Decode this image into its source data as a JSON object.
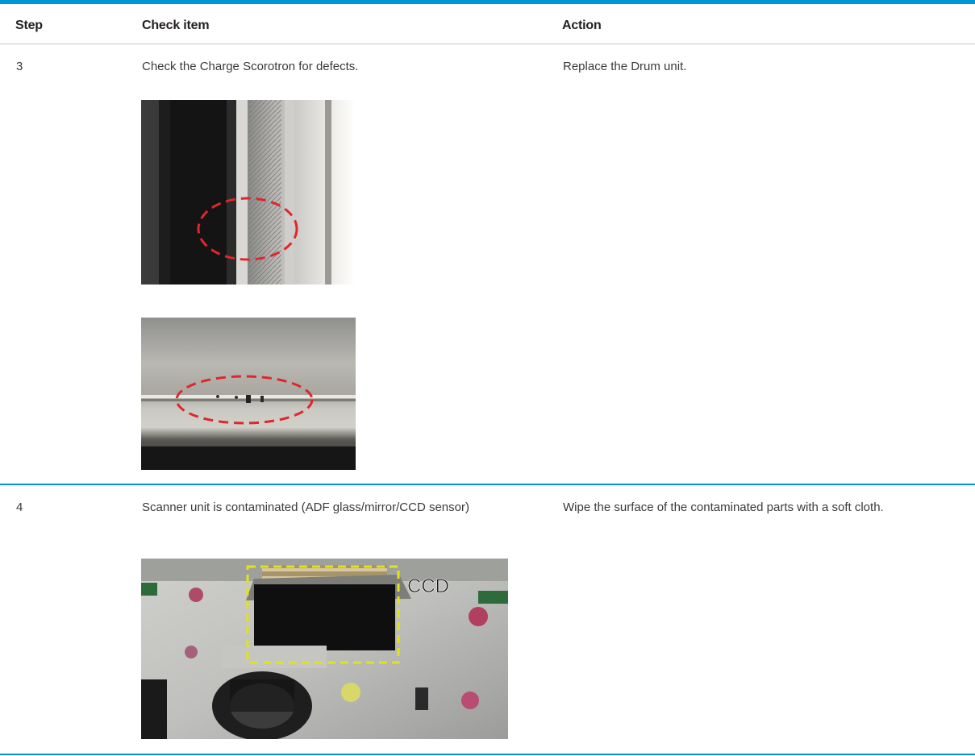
{
  "table": {
    "headers": {
      "step": "Step",
      "check_item": "Check item",
      "action": "Action"
    },
    "rows": [
      {
        "step": "3",
        "check_item": "Check the Charge Scorotron for defects.",
        "action": "Replace the Drum unit."
      },
      {
        "step": "4",
        "check_item": "Scanner unit is contaminated (ADF glass/mirror/CCD sensor)",
        "action": "Wipe the surface of the contaminated parts with a soft cloth.",
        "image_label": "CCD"
      }
    ]
  },
  "colors": {
    "rule": "#0096d6",
    "defect_marker": "#e0262b",
    "ccd_marker": "#e2e21a"
  }
}
